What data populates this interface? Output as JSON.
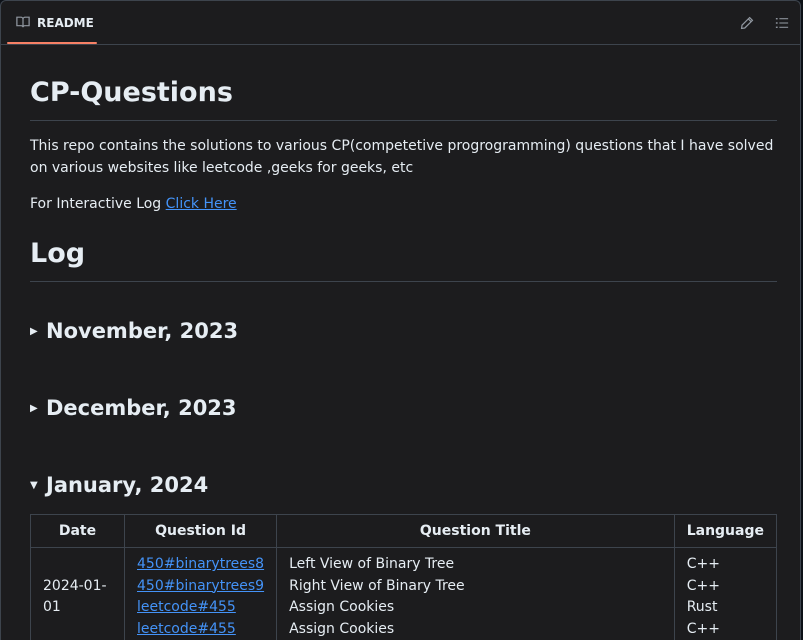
{
  "tab": {
    "label": "README",
    "icon": "book-icon"
  },
  "toolbar": {
    "edit_icon": "pencil-icon",
    "outline_icon": "list-unordered-icon"
  },
  "readme": {
    "title": "CP-Questions",
    "description": "This repo contains the solutions to various CP(competetive progrogramming) questions that I have solved on various websites like leetcode ,geeks for geeks, etc",
    "interactive_prefix": "For Interactive Log ",
    "interactive_link": "Click Here",
    "log_heading": "Log",
    "months": [
      {
        "label": "November, 2023",
        "expanded": false
      },
      {
        "label": "December, 2023",
        "expanded": false
      },
      {
        "label": "January, 2024",
        "expanded": true
      }
    ],
    "table": {
      "headers": [
        "Date",
        "Question Id",
        "Question Title",
        "Language"
      ],
      "rows": [
        {
          "date": "2024-01-01",
          "ids": [
            "450#binarytrees8",
            "450#binarytrees9",
            "leetcode#455",
            "leetcode#455"
          ],
          "titles": [
            "Left View of Binary Tree",
            "Right View of Binary Tree",
            "Assign Cookies",
            "Assign Cookies"
          ],
          "languages": [
            "C++",
            "C++",
            "Rust",
            "C++"
          ]
        }
      ]
    }
  }
}
